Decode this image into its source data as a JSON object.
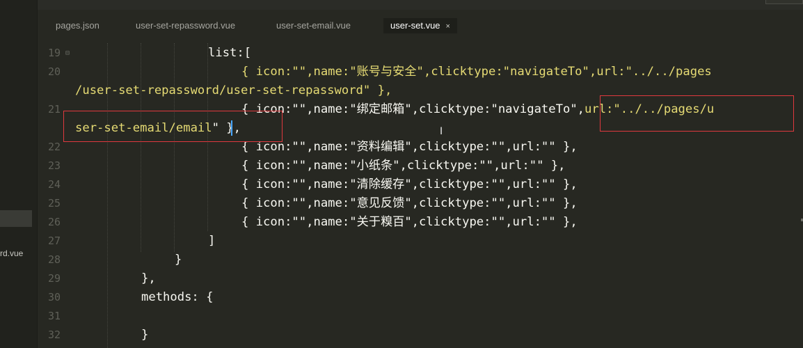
{
  "sidebar": {
    "visible_file": "rd.vue"
  },
  "tabs": [
    {
      "label": "pages.json",
      "active": false
    },
    {
      "label": "user-set-repassword.vue",
      "active": false
    },
    {
      "label": "user-set-email.vue",
      "active": false
    },
    {
      "label": "user-set.vue",
      "active": true,
      "close": "×"
    }
  ],
  "editor": {
    "line_numbers": [
      "19",
      "20",
      "",
      "21",
      "",
      "22",
      "23",
      "24",
      "25",
      "26",
      "27",
      "28",
      "29",
      "30",
      "31",
      "32"
    ],
    "fold_marker": "⊟",
    "lines": {
      "l19": "list:[",
      "l20a": "{ icon:\"\",name:\"账号与安全\",clicktype:\"navigateTo\",url:\"../../pages",
      "l20b": "/user-set-repassword/user-set-repassword\" },",
      "l21a_pre": "{ icon:\"\",name:\"绑定邮箱\",clicktype:\"navigateTo\",",
      "l21a_url": "url:\"../../pages/u",
      "l21b_path": "ser-set-email/email",
      "l21b_rest": "\" },",
      "l22": "{ icon:\"\",name:\"资料编辑\",clicktype:\"\",url:\"\" },",
      "l23": "{ icon:\"\",name:\"小纸条\",clicktype:\"\",url:\"\" },",
      "l24": "{ icon:\"\",name:\"清除缓存\",clicktype:\"\",url:\"\" },",
      "l25": "{ icon:\"\",name:\"意见反馈\",clicktype:\"\",url:\"\" },",
      "l26": "{ icon:\"\",name:\"关于糗百\",clicktype:\"\",url:\"\" },",
      "l27": "]",
      "l28": "}",
      "l29": "},",
      "l30": "methods: {",
      "l31": "",
      "l32": "}"
    }
  },
  "cursor_icon": "I"
}
